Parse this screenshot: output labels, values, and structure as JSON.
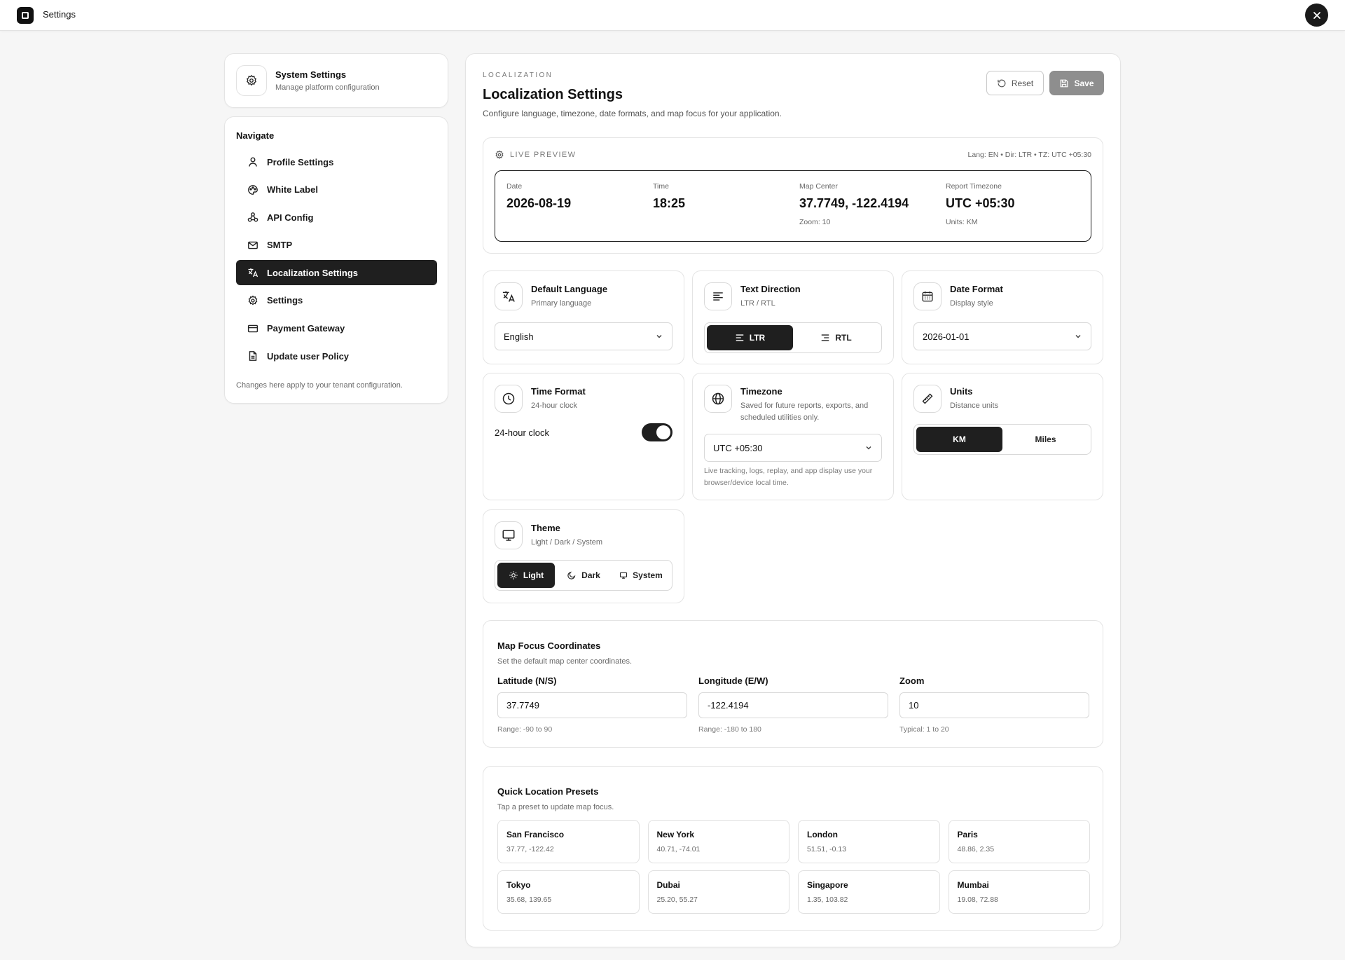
{
  "app": {
    "title": "Settings"
  },
  "sidebar": {
    "header": {
      "title": "System Settings",
      "subtitle": "Manage platform configuration"
    },
    "nav_title": "Navigate",
    "items": [
      {
        "label": "Profile Settings",
        "icon": "user-icon"
      },
      {
        "label": "White Label",
        "icon": "palette-icon"
      },
      {
        "label": "API Config",
        "icon": "webhook-icon"
      },
      {
        "label": "SMTP",
        "icon": "mail-icon"
      },
      {
        "label": "Localization Settings",
        "icon": "translate-icon",
        "active": true
      },
      {
        "label": "Settings",
        "icon": "gear-icon"
      },
      {
        "label": "Payment Gateway",
        "icon": "credit-card-icon"
      },
      {
        "label": "Update user Policy",
        "icon": "document-icon"
      }
    ],
    "footer": "Changes here apply to your tenant configuration."
  },
  "main": {
    "eyebrow": "LOCALIZATION",
    "title": "Localization Settings",
    "subtitle": "Configure language, timezone, date formats, and map focus for your application.",
    "actions": {
      "reset": "Reset",
      "save": "Save"
    }
  },
  "preview": {
    "heading": "LIVE PREVIEW",
    "meta": "Lang: EN • Dir: LTR • TZ: UTC +05:30",
    "date": {
      "label": "Date",
      "value": "2026-08-19"
    },
    "time": {
      "label": "Time",
      "value": "18:25"
    },
    "map": {
      "label": "Map Center",
      "value": "37.7749, -122.4194",
      "extra": "Zoom: 10"
    },
    "tz": {
      "label": "Report Timezone",
      "value": "UTC +05:30",
      "extra": "Units: KM"
    }
  },
  "language": {
    "title": "Default Language",
    "subtitle": "Primary language",
    "value": "English"
  },
  "direction": {
    "title": "Text Direction",
    "subtitle": "LTR / RTL",
    "options": [
      "LTR",
      "RTL"
    ],
    "selected": "LTR"
  },
  "date_format": {
    "title": "Date Format",
    "subtitle": "Display style",
    "value": "2026-01-01"
  },
  "time_format": {
    "title": "Time Format",
    "subtitle": "24-hour clock",
    "toggle_label": "24-hour clock",
    "enabled": true
  },
  "timezone": {
    "title": "Timezone",
    "subtitle": "Saved for future reports, exports, and scheduled utilities only.",
    "value": "UTC +05:30",
    "hint": "Live tracking, logs, replay, and app display use your browser/device local time."
  },
  "units": {
    "title": "Units",
    "subtitle": "Distance units",
    "options": [
      "KM",
      "Miles"
    ],
    "selected": "KM"
  },
  "theme": {
    "title": "Theme",
    "subtitle": "Light / Dark / System",
    "options": [
      "Light",
      "Dark",
      "System"
    ],
    "selected": "Light"
  },
  "map_focus": {
    "title": "Map Focus Coordinates",
    "subtitle": "Set the default map center coordinates.",
    "latitude": {
      "label": "Latitude (N/S)",
      "value": "37.7749",
      "hint": "Range: -90 to 90"
    },
    "longitude": {
      "label": "Longitude (E/W)",
      "value": "-122.4194",
      "hint": "Range: -180 to 180"
    },
    "zoom": {
      "label": "Zoom",
      "value": "10",
      "hint": "Typical: 1 to 20"
    }
  },
  "presets": {
    "title": "Quick Location Presets",
    "subtitle": "Tap a preset to update map focus.",
    "items": [
      {
        "name": "San Francisco",
        "coords": "37.77, -122.42"
      },
      {
        "name": "New York",
        "coords": "40.71, -74.01"
      },
      {
        "name": "London",
        "coords": "51.51, -0.13"
      },
      {
        "name": "Paris",
        "coords": "48.86, 2.35"
      },
      {
        "name": "Tokyo",
        "coords": "35.68, 139.65"
      },
      {
        "name": "Dubai",
        "coords": "25.20, 55.27"
      },
      {
        "name": "Singapore",
        "coords": "1.35, 103.82"
      },
      {
        "name": "Mumbai",
        "coords": "19.08, 72.88"
      }
    ]
  },
  "colors": {
    "accent": "#1f1f1f",
    "save_button": "#8e8e8e",
    "background": "#f6f6f6"
  }
}
